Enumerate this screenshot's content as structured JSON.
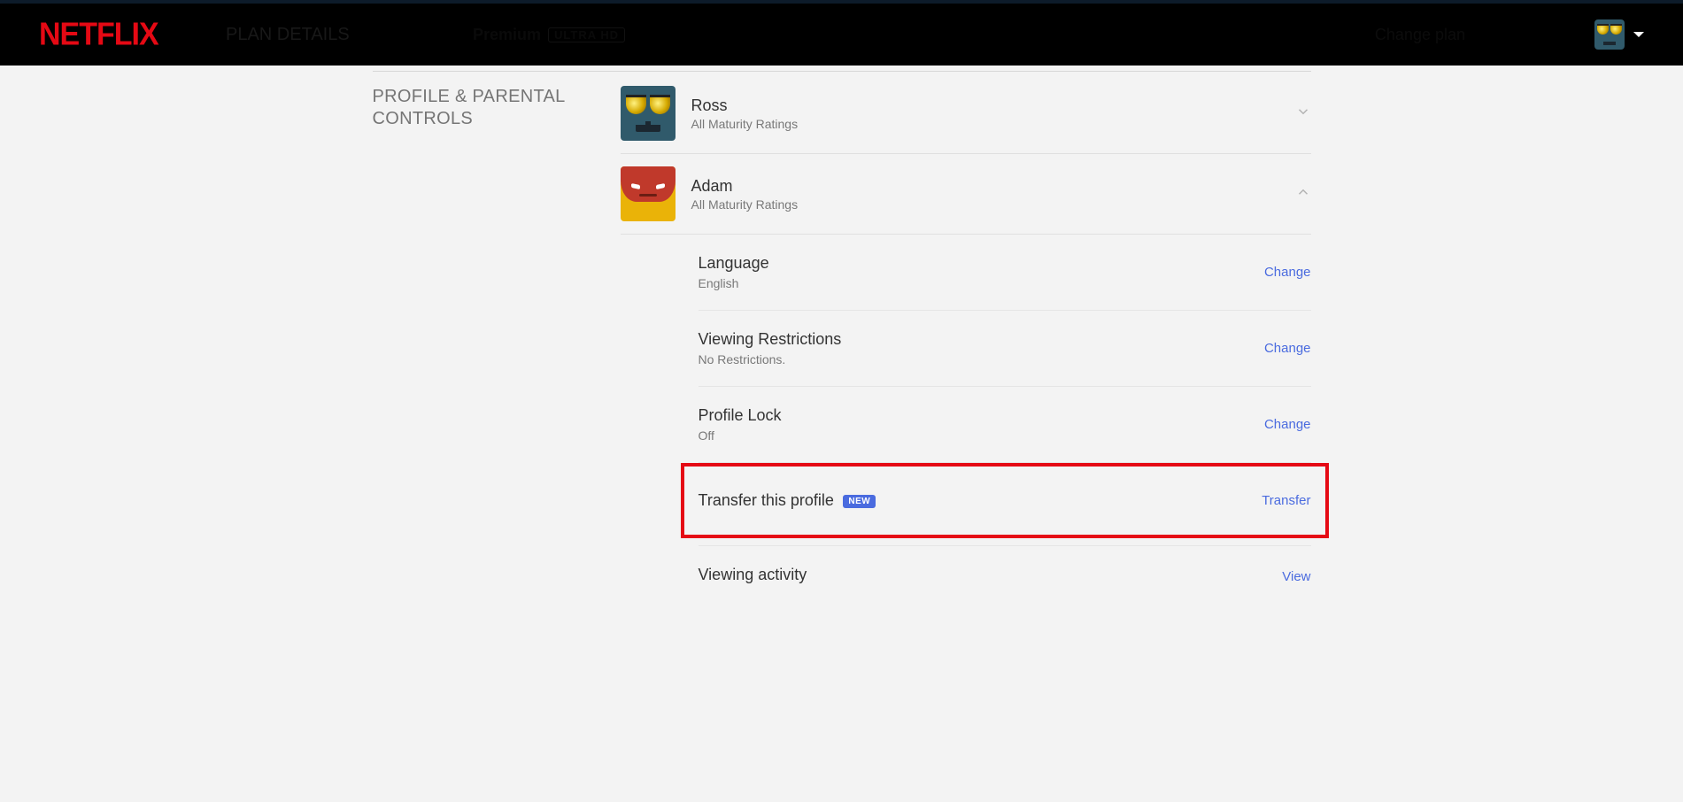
{
  "brand": "NETFLIX",
  "plan": {
    "label": "PLAN DETAILS",
    "name": "Premium",
    "badge": "ULTRA HD",
    "action": "Change plan"
  },
  "section_title": "PROFILE & PARENTAL CONTROLS",
  "profiles": [
    {
      "name": "Ross",
      "maturity": "All Maturity Ratings",
      "expanded": false
    },
    {
      "name": "Adam",
      "maturity": "All Maturity Ratings",
      "expanded": true
    }
  ],
  "settings": {
    "language": {
      "title": "Language",
      "value": "English",
      "action": "Change"
    },
    "restrictions": {
      "title": "Viewing Restrictions",
      "value": "No Restrictions.",
      "action": "Change"
    },
    "lock": {
      "title": "Profile Lock",
      "value": "Off",
      "action": "Change"
    },
    "transfer": {
      "title": "Transfer this profile",
      "badge": "NEW",
      "action": "Transfer"
    },
    "activity": {
      "title": "Viewing activity",
      "action": "View"
    }
  }
}
